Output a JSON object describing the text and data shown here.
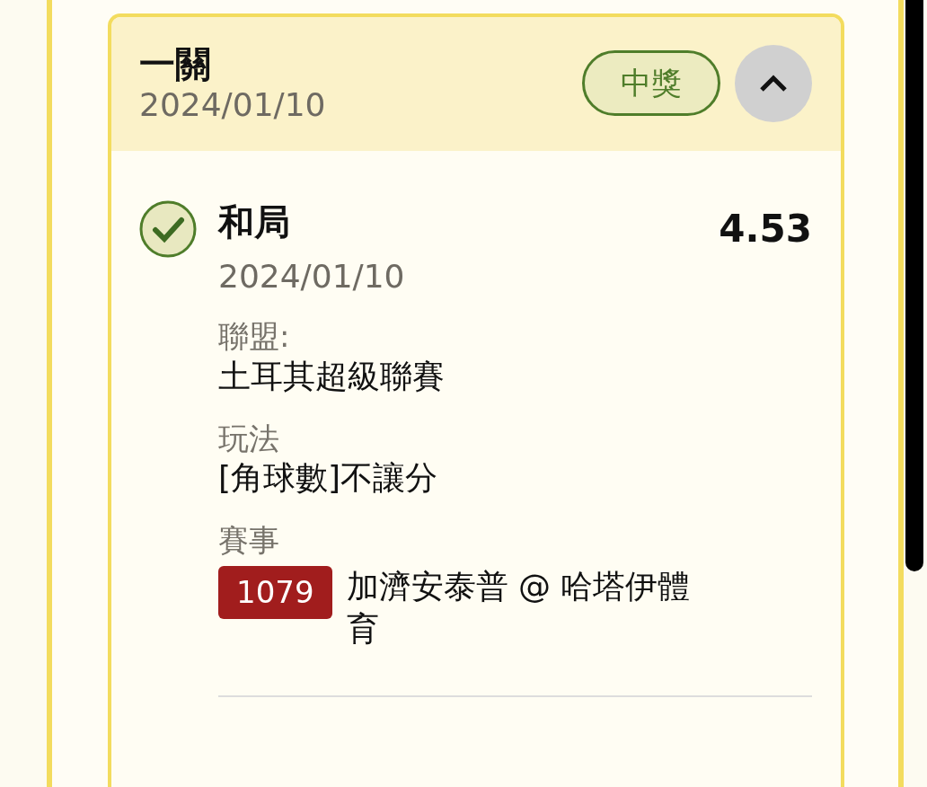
{
  "bet": {
    "title": "一關",
    "date": "2024/01/10",
    "status": "中獎",
    "expanded": true
  },
  "selections": [
    {
      "name": "和局",
      "date": "2024/01/10",
      "odds": "4.53",
      "won": true,
      "fields": [
        {
          "kind": "text",
          "label": "聯盟:",
          "value": "土耳其超級聯賽"
        },
        {
          "kind": "text",
          "label": "玩法",
          "value": "[角球數]不讓分"
        },
        {
          "kind": "match",
          "label": "賽事",
          "match_no": "1079",
          "value": "加濟安泰普 @ 哈塔伊體育"
        }
      ]
    }
  ]
}
